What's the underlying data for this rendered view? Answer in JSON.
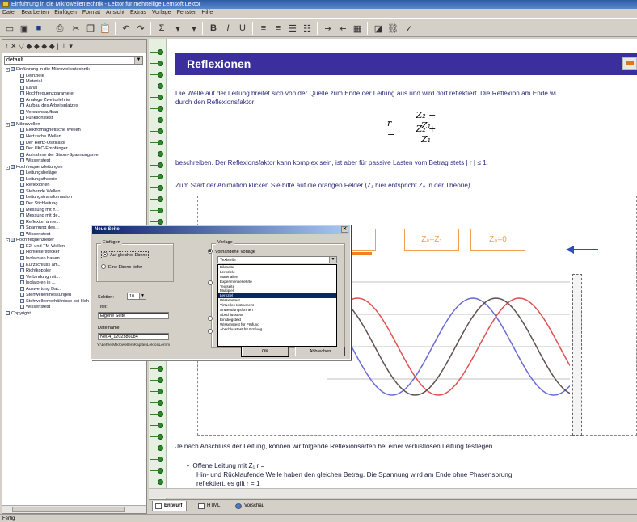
{
  "window": {
    "title": "Einführung in die Mikrowellentechnik - Lektor für mehrteilige Lernsoft Lektor",
    "menu": [
      "Datei",
      "Bearbeiten",
      "Einfügen",
      "Format",
      "Ansicht",
      "Extras",
      "Vorlage",
      "Fenster",
      "Hilfe"
    ]
  },
  "left_pane": {
    "combo_value": "default",
    "tree": [
      {
        "level": 0,
        "label": "Einführung in die Mikrowellentechnik",
        "expander": "-",
        "icon": "book"
      },
      {
        "level": 1,
        "label": "Lernziele",
        "icon": "page"
      },
      {
        "level": 1,
        "label": "Material",
        "icon": "page"
      },
      {
        "level": 1,
        "label": "Kanal",
        "icon": "page"
      },
      {
        "level": 1,
        "label": "Hochfrequenzparameter",
        "icon": "page"
      },
      {
        "level": 1,
        "label": "Analoge Zweitorlehrte",
        "icon": "page"
      },
      {
        "level": 1,
        "label": "Aufbau des Arbeitsplatzes",
        "icon": "page"
      },
      {
        "level": 1,
        "label": "Versuchsaufbau",
        "icon": "page"
      },
      {
        "level": 1,
        "label": "Funktionstest",
        "icon": "page"
      },
      {
        "level": 0,
        "label": "Mikrowellen",
        "expander": "-",
        "icon": "book"
      },
      {
        "level": 1,
        "label": "Elektromagnetische Wellen",
        "icon": "page"
      },
      {
        "level": 1,
        "label": "Hertzsche Wellen",
        "icon": "page"
      },
      {
        "level": 1,
        "label": "Der Hertz-Oszillator",
        "icon": "page"
      },
      {
        "level": 1,
        "label": "Der UKC-Empfänger",
        "icon": "page"
      },
      {
        "level": 1,
        "label": "Aufnahme der Strom-Spannungsme",
        "icon": "page"
      },
      {
        "level": 1,
        "label": "Wissenstest",
        "icon": "page"
      },
      {
        "level": 0,
        "label": "Hochfrequenzleitungen",
        "expander": "-",
        "icon": "book"
      },
      {
        "level": 1,
        "label": "Leitungsbeläge",
        "icon": "page"
      },
      {
        "level": 1,
        "label": "Leitungstheorie",
        "icon": "page"
      },
      {
        "level": 1,
        "label": "Reflexionen",
        "icon": "page"
      },
      {
        "level": 1,
        "label": "Stehende Wellen",
        "icon": "page"
      },
      {
        "level": 1,
        "label": "Leitungstransformation",
        "icon": "page"
      },
      {
        "level": 1,
        "label": "Der Stichleitung",
        "icon": "page"
      },
      {
        "level": 1,
        "label": "Messung mit Y...",
        "icon": "page"
      },
      {
        "level": 1,
        "label": "Messung mit de...",
        "icon": "page"
      },
      {
        "level": 1,
        "label": "Reflexion am e...",
        "icon": "page"
      },
      {
        "level": 1,
        "label": "Spannung des...",
        "icon": "page"
      },
      {
        "level": 1,
        "label": "Wissenstest",
        "icon": "page"
      },
      {
        "level": 0,
        "label": "Hochfrequenzleiter",
        "expander": "-",
        "icon": "book"
      },
      {
        "level": 1,
        "label": "E2- und TM-Wellen",
        "icon": "page"
      },
      {
        "level": 1,
        "label": "Hohlleiterstecker",
        "icon": "page"
      },
      {
        "level": 1,
        "label": "Isolatoren bauen",
        "icon": "page"
      },
      {
        "level": 1,
        "label": "Kurzschluss am...",
        "icon": "page"
      },
      {
        "level": 1,
        "label": "Richtkoppler",
        "icon": "page"
      },
      {
        "level": 1,
        "label": "Verbindung mit...",
        "icon": "page"
      },
      {
        "level": 1,
        "label": "Isolatoren in ...",
        "icon": "page"
      },
      {
        "level": 1,
        "label": "Auswertung Dat...",
        "icon": "page"
      },
      {
        "level": 1,
        "label": "Stehwellenmessungen",
        "icon": "page"
      },
      {
        "level": 1,
        "label": "Stehwellenverhältnisse bei Hoh",
        "icon": "page"
      },
      {
        "level": 1,
        "label": "Wissenstest",
        "icon": "page"
      },
      {
        "level": 0,
        "label": "Copyright",
        "icon": "page"
      }
    ]
  },
  "document": {
    "header": "Reflexionen",
    "para1_line1": "Die Welle auf der Leitung breitet sich von der Quelle zum Ende der Leitung aus und wird dort reflektiert. Die Reflexion am Ende wi",
    "para1_line2": "durch den Reflexionsfaktor",
    "formula": {
      "lhs": "r =",
      "numerator": "Z₂ − Z₁",
      "denominator": "Z₂ + Z₁"
    },
    "para2": "beschreiben. Der Reflexionsfaktor kann komplex sein, ist aber für passive Lasten vom Betrag stets | r | ≤ 1.",
    "para3": "Zum Start der Animation klicken Sie bitte auf die orangen Felder (Z₁ hier entspricht Z₀ in der Theorie).",
    "anim_boxes": [
      "∞",
      "Z₀=Z₁",
      "Z₀=0"
    ],
    "para4": "Je nach Abschluss der Leitung, können wir folgende Reflexionsarten bei einer verlustlosen Leitung festlegen",
    "bullet1": "Offene Leitung mit Z₁  r =",
    "bullet1_line2": "Hin- und Rücklaufende Welle haben den gleichen Betrag. Die Spannung wird am Ende ohne Phasensprung",
    "bullet1_line3": "reflektiert, es gilt r = 1"
  },
  "dialog": {
    "title": "Neue Seite",
    "group_insert": "Einfügen",
    "radio_same_level": "Auf gleicher Ebene",
    "radio_level_down": "Eine Ebene tiefer",
    "section_label": "Sektion:",
    "section_value": "10",
    "title_label": "Titel:",
    "title_value": "Eigene Seite",
    "filename_label": "Dateiname:",
    "filename_value": "Neu4_1202386084",
    "group_template": "Vorlage",
    "radio_existing": "Vorhandene Vorlage",
    "combo_value": "Textseite",
    "options": [
      "Bildseite",
      "Lernziele",
      "Materialien",
      "Experimentierlehrte",
      "Textseite",
      "Multiplelt",
      "Lernziel",
      "Wissenstest",
      "Virtuelles Instrument",
      "Anwendungsformen",
      "Abschlusstext",
      "Einstiegstext",
      "Wissenstest für Prüfung",
      "Abschlusstest für Prüfung"
    ],
    "selected_index": 6,
    "path_label": "Y:\\Lehre\\Mikrowellen\\Kapitel\\Lektor\\Lernm",
    "ok": "OK",
    "cancel": "Abbrechen"
  },
  "bottom_tabs": [
    "Entwurf",
    "HTML",
    "Vorschau"
  ],
  "status": "Fertig",
  "colors": {
    "header_bg": "#3b2f9e",
    "body_text": "#2a2a7a",
    "orange": "#f0a050",
    "wave_red": "#e05050",
    "wave_blue": "#6a6ad8",
    "wave_dark": "#605050"
  }
}
